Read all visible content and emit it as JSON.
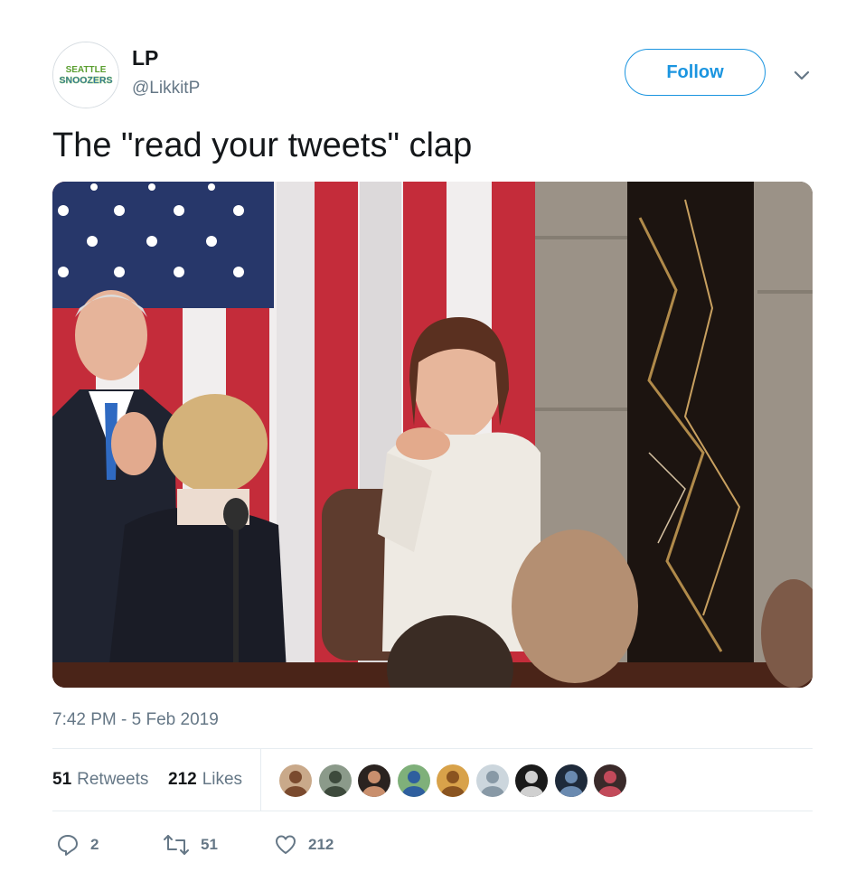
{
  "author": {
    "avatar_text": [
      "SEATTLE",
      "SNOOZERS"
    ],
    "name": "LP",
    "handle": "@LikkitP"
  },
  "follow_label": "Follow",
  "tweet_text": "The \"read your tweets\" clap",
  "timestamp": "7:42 PM - 5 Feb 2019",
  "stats": {
    "retweets_count": "51",
    "retweets_label": "Retweets",
    "likes_count": "212",
    "likes_label": "Likes"
  },
  "likers": [
    {
      "name": "liker-avatar-1",
      "bg": "#c9a98a",
      "fg": "#7a4a2e"
    },
    {
      "name": "liker-avatar-2",
      "bg": "#8b9a8a",
      "fg": "#3d4a3c"
    },
    {
      "name": "liker-avatar-3",
      "bg": "#2a2320",
      "fg": "#c98f6d"
    },
    {
      "name": "liker-avatar-4",
      "bg": "#7fb07a",
      "fg": "#2f5f9e"
    },
    {
      "name": "liker-avatar-5",
      "bg": "#d8a24a",
      "fg": "#8a5420"
    },
    {
      "name": "liker-avatar-6",
      "bg": "#ccd6dd",
      "fg": "#8899a6"
    },
    {
      "name": "liker-avatar-7",
      "bg": "#1a1a1a",
      "fg": "#d0d0d0"
    },
    {
      "name": "liker-avatar-8",
      "bg": "#1e2a3a",
      "fg": "#6a8ab0"
    },
    {
      "name": "liker-avatar-9",
      "bg": "#3a2a2a",
      "fg": "#c24a5a"
    }
  ],
  "actions": {
    "reply_count": "2",
    "retweet_count": "51",
    "like_count": "212"
  },
  "icons": {
    "caret": "chevron-down-icon",
    "reply": "reply-icon",
    "retweet": "retweet-icon",
    "like": "heart-icon"
  },
  "colors": {
    "accent": "#1b95e0",
    "secondary_text": "#657786",
    "primary_text": "#14171a",
    "divider": "#e6ecf0"
  }
}
